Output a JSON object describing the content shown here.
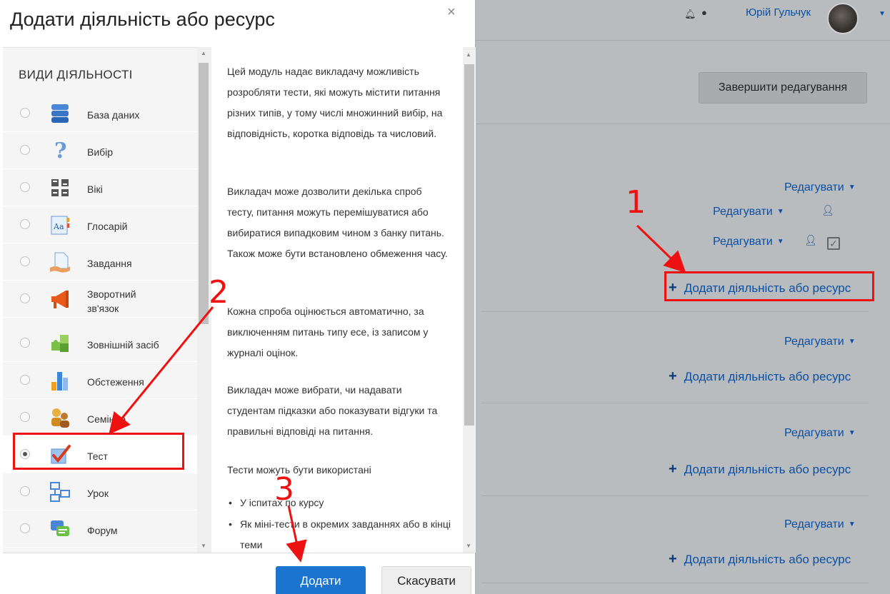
{
  "header": {
    "user_name": "Юрій Гульчук",
    "finish_editing": "Завершити редагування"
  },
  "page": {
    "edit_label": "Редагувати",
    "add_activity": "Додати діяльність або ресурс"
  },
  "modal": {
    "title": "Додати діяльність або ресурс",
    "close": "×",
    "types_heading": "ВИДИ ДІЯЛЬНОСТІ",
    "activities": [
      {
        "label": "База даних",
        "icon": "database-icon"
      },
      {
        "label": "Вибір",
        "icon": "question-icon"
      },
      {
        "label": "Вікі",
        "icon": "wiki-icon"
      },
      {
        "label": "Глосарій",
        "icon": "glossary-icon"
      },
      {
        "label": "Завдання",
        "icon": "assignment-icon"
      },
      {
        "label": "Зворотний зв'язок",
        "icon": "megaphone-icon"
      },
      {
        "label": "Зовнішній засіб",
        "icon": "puzzle-icon"
      },
      {
        "label": "Обстеження",
        "icon": "bar-chart-icon"
      },
      {
        "label": "Семінар",
        "icon": "workshop-icon"
      },
      {
        "label": "Тест",
        "icon": "quiz-check-icon",
        "selected": true
      },
      {
        "label": "Урок",
        "icon": "lesson-icon"
      },
      {
        "label": "Форум",
        "icon": "forum-icon"
      }
    ],
    "description": {
      "p1": "Цей модуль надає викладачу можливість розробляти тести, які можуть містити питання різних типів, у тому числі множинний вибір, на відповідність, коротка відповідь та числовий.",
      "p2": "Викладач може дозволити декілька спроб тесту, питання можуть перемішуватися або вибиратися випадковим чином з банку питань. Також може бути встановлено обмеження часу.",
      "p3": "Кожна спроба оцінюється автоматично, за виключенням питань типу есе, із записом у журналі оцінок.",
      "p4": "Викладач може вибрати, чи надавати студентам підказки або показувати відгуки та правильні відповіді на питання.",
      "p5": "Тести можуть бути використані",
      "li1": "У іспитах по курсу",
      "li2": "Як міні-тести в окремих завданнях або в кінці теми"
    },
    "add_button": "Додати",
    "cancel_button": "Скасувати"
  },
  "annotations": {
    "step1": "1",
    "step2": "2",
    "step3": "3"
  },
  "colors": {
    "accent": "#1a74d0",
    "link": "#0a4fa3",
    "annotation": "#ee1111"
  }
}
